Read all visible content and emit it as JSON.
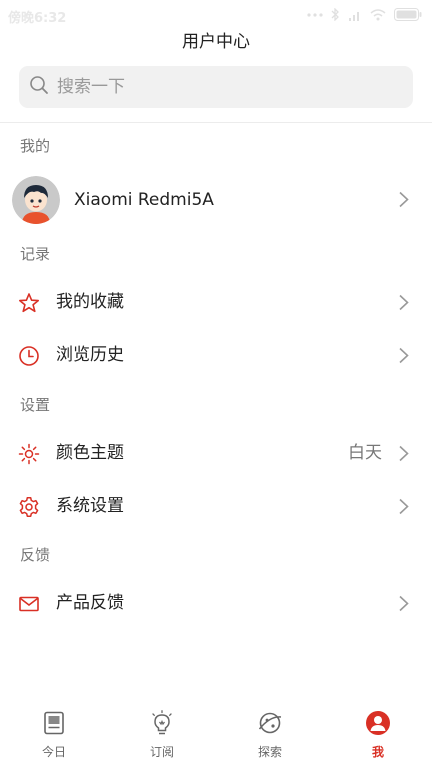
{
  "status_bar": {
    "time": "傍晚6:32"
  },
  "header": {
    "title": "用户中心"
  },
  "search": {
    "placeholder": "搜索一下"
  },
  "sections": {
    "mine": "我的",
    "records": "记录",
    "settings": "设置",
    "feedback": "反馈"
  },
  "profile": {
    "name": "Xiaomi Redmi5A"
  },
  "rows": {
    "favorites": {
      "label": "我的收藏",
      "icon": "star-icon"
    },
    "history": {
      "label": "浏览历史",
      "icon": "clock-icon"
    },
    "theme": {
      "label": "颜色主题",
      "value": "白天",
      "icon": "sun-icon"
    },
    "system": {
      "label": "系统设置",
      "icon": "gear-icon"
    },
    "product_feedback": {
      "label": "产品反馈",
      "icon": "mail-icon"
    }
  },
  "bottom_nav": [
    {
      "label": "今日",
      "icon": "newspaper-icon",
      "active": false
    },
    {
      "label": "订阅",
      "icon": "lightbulb-icon",
      "active": false
    },
    {
      "label": "探索",
      "icon": "planet-icon",
      "active": false
    },
    {
      "label": "我",
      "icon": "user-icon",
      "active": true
    }
  ],
  "colors": {
    "accent": "#d93025",
    "text": "#222222",
    "muted": "#777777",
    "search_bg": "#f1f1f1"
  }
}
